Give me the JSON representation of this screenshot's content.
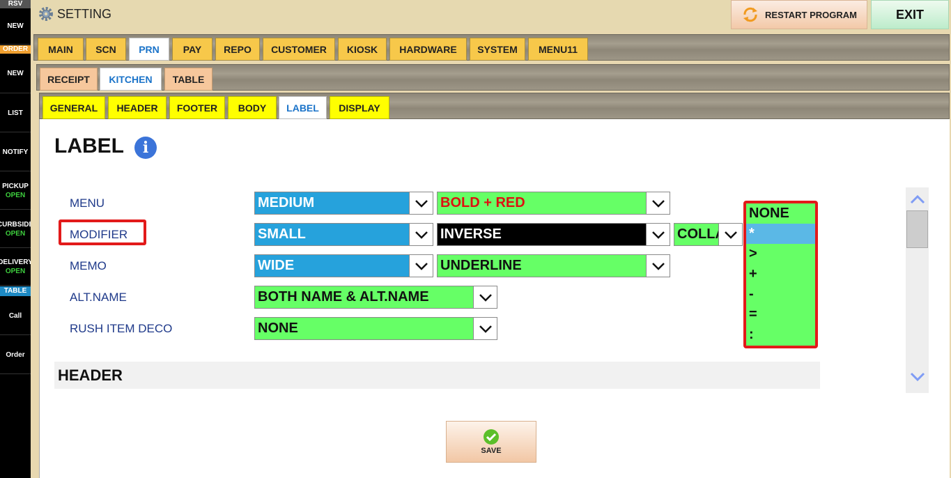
{
  "sidebar": {
    "rsv": "RSV",
    "new1": "NEW",
    "order_badge": "ORDER",
    "new2": "NEW",
    "list": "LIST",
    "notify": "NOTIFY",
    "pickup": "PICKUP",
    "pickup_status": "OPEN",
    "curbside": "CURBSIDE",
    "curbside_status": "OPEN",
    "delivery": "DELIVERY",
    "delivery_status": "OPEN",
    "table_badge": "TABLE",
    "call": "Call",
    "order": "Order"
  },
  "titlebar": {
    "title": "SETTING",
    "restart_label": "RESTART PROGRAM",
    "exit_label": "EXIT"
  },
  "main_tabs": [
    "MAIN",
    "SCN",
    "PRN",
    "PAY",
    "REPO",
    "CUSTOMER",
    "KIOSK",
    "HARDWARE",
    "SYSTEM",
    "MENU11"
  ],
  "prn_tabs": [
    "RECEIPT",
    "KITCHEN",
    "TABLE"
  ],
  "kitchen_tabs": [
    "GENERAL",
    "HEADER",
    "FOOTER",
    "BODY",
    "LABEL",
    "DISPLAY"
  ],
  "content": {
    "heading": "LABEL",
    "rows": [
      {
        "label": "MENU",
        "size": "MEDIUM",
        "style": "BOLD + RED"
      },
      {
        "label": "MODIFIER",
        "size": "SMALL",
        "style": "INVERSE",
        "extra": "COLLAPSE"
      },
      {
        "label": "MEMO",
        "size": "WIDE",
        "style": "UNDERLINE"
      },
      {
        "label": "ALT.NAME",
        "value": "BOTH NAME & ALT.NAME"
      },
      {
        "label": "RUSH ITEM DECO",
        "value": "NONE"
      }
    ],
    "prefix_options": [
      "NONE",
      "*",
      ">",
      "+",
      "-",
      "=",
      ":"
    ],
    "prefix_selected": "*",
    "header_section": "HEADER",
    "save_label": "SAVE"
  },
  "colors": {
    "select_blue": "#26a2dc",
    "select_green": "#66ff66",
    "highlight_red": "#e21a1a",
    "tab_gold": "#f7c84a",
    "tab_yellow": "#ffff00"
  }
}
